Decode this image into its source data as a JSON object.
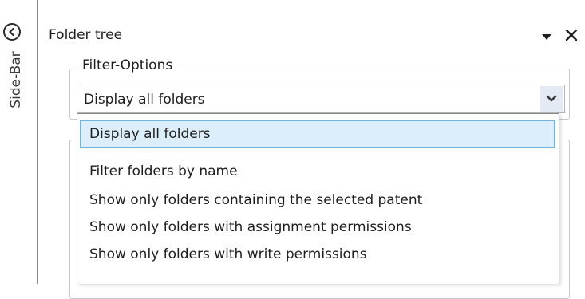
{
  "sidebar": {
    "label": "Side-Bar"
  },
  "panel": {
    "title": "Folder tree"
  },
  "filter": {
    "legend": "Filter-Options",
    "selected": "Display all folders",
    "options": [
      "Display all folders",
      "Filter folders by name",
      "Show only folders containing the selected patent",
      "Show only folders with assignment permissions",
      "Show only folders with write permissions"
    ]
  },
  "colors": {
    "selection_bg": "#dbeefa",
    "selection_border": "#6fb4e1",
    "combo_arrow_bg": "#e3eaf3"
  },
  "icons": {
    "collapse": "chevron-left-circle-icon",
    "pin": "caret-down-icon",
    "close": "close-icon",
    "dropdown": "chevron-down-icon"
  }
}
